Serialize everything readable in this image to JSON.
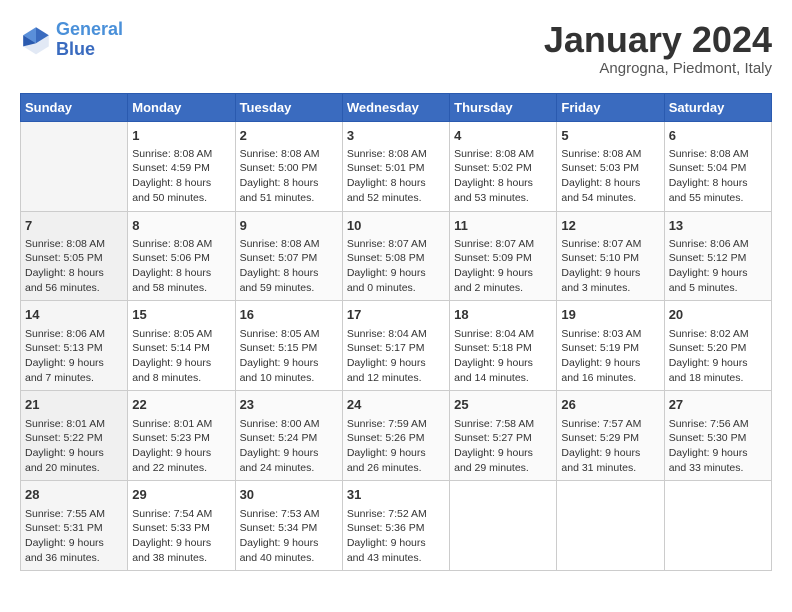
{
  "header": {
    "logo_line1": "General",
    "logo_line2": "Blue",
    "month_title": "January 2024",
    "subtitle": "Angrogna, Piedmont, Italy"
  },
  "weekdays": [
    "Sunday",
    "Monday",
    "Tuesday",
    "Wednesday",
    "Thursday",
    "Friday",
    "Saturday"
  ],
  "weeks": [
    [
      {
        "day": "",
        "info": ""
      },
      {
        "day": "1",
        "info": "Sunrise: 8:08 AM\nSunset: 4:59 PM\nDaylight: 8 hours\nand 50 minutes."
      },
      {
        "day": "2",
        "info": "Sunrise: 8:08 AM\nSunset: 5:00 PM\nDaylight: 8 hours\nand 51 minutes."
      },
      {
        "day": "3",
        "info": "Sunrise: 8:08 AM\nSunset: 5:01 PM\nDaylight: 8 hours\nand 52 minutes."
      },
      {
        "day": "4",
        "info": "Sunrise: 8:08 AM\nSunset: 5:02 PM\nDaylight: 8 hours\nand 53 minutes."
      },
      {
        "day": "5",
        "info": "Sunrise: 8:08 AM\nSunset: 5:03 PM\nDaylight: 8 hours\nand 54 minutes."
      },
      {
        "day": "6",
        "info": "Sunrise: 8:08 AM\nSunset: 5:04 PM\nDaylight: 8 hours\nand 55 minutes."
      }
    ],
    [
      {
        "day": "7",
        "info": "Sunrise: 8:08 AM\nSunset: 5:05 PM\nDaylight: 8 hours\nand 56 minutes."
      },
      {
        "day": "8",
        "info": "Sunrise: 8:08 AM\nSunset: 5:06 PM\nDaylight: 8 hours\nand 58 minutes."
      },
      {
        "day": "9",
        "info": "Sunrise: 8:08 AM\nSunset: 5:07 PM\nDaylight: 8 hours\nand 59 minutes."
      },
      {
        "day": "10",
        "info": "Sunrise: 8:07 AM\nSunset: 5:08 PM\nDaylight: 9 hours\nand 0 minutes."
      },
      {
        "day": "11",
        "info": "Sunrise: 8:07 AM\nSunset: 5:09 PM\nDaylight: 9 hours\nand 2 minutes."
      },
      {
        "day": "12",
        "info": "Sunrise: 8:07 AM\nSunset: 5:10 PM\nDaylight: 9 hours\nand 3 minutes."
      },
      {
        "day": "13",
        "info": "Sunrise: 8:06 AM\nSunset: 5:12 PM\nDaylight: 9 hours\nand 5 minutes."
      }
    ],
    [
      {
        "day": "14",
        "info": "Sunrise: 8:06 AM\nSunset: 5:13 PM\nDaylight: 9 hours\nand 7 minutes."
      },
      {
        "day": "15",
        "info": "Sunrise: 8:05 AM\nSunset: 5:14 PM\nDaylight: 9 hours\nand 8 minutes."
      },
      {
        "day": "16",
        "info": "Sunrise: 8:05 AM\nSunset: 5:15 PM\nDaylight: 9 hours\nand 10 minutes."
      },
      {
        "day": "17",
        "info": "Sunrise: 8:04 AM\nSunset: 5:17 PM\nDaylight: 9 hours\nand 12 minutes."
      },
      {
        "day": "18",
        "info": "Sunrise: 8:04 AM\nSunset: 5:18 PM\nDaylight: 9 hours\nand 14 minutes."
      },
      {
        "day": "19",
        "info": "Sunrise: 8:03 AM\nSunset: 5:19 PM\nDaylight: 9 hours\nand 16 minutes."
      },
      {
        "day": "20",
        "info": "Sunrise: 8:02 AM\nSunset: 5:20 PM\nDaylight: 9 hours\nand 18 minutes."
      }
    ],
    [
      {
        "day": "21",
        "info": "Sunrise: 8:01 AM\nSunset: 5:22 PM\nDaylight: 9 hours\nand 20 minutes."
      },
      {
        "day": "22",
        "info": "Sunrise: 8:01 AM\nSunset: 5:23 PM\nDaylight: 9 hours\nand 22 minutes."
      },
      {
        "day": "23",
        "info": "Sunrise: 8:00 AM\nSunset: 5:24 PM\nDaylight: 9 hours\nand 24 minutes."
      },
      {
        "day": "24",
        "info": "Sunrise: 7:59 AM\nSunset: 5:26 PM\nDaylight: 9 hours\nand 26 minutes."
      },
      {
        "day": "25",
        "info": "Sunrise: 7:58 AM\nSunset: 5:27 PM\nDaylight: 9 hours\nand 29 minutes."
      },
      {
        "day": "26",
        "info": "Sunrise: 7:57 AM\nSunset: 5:29 PM\nDaylight: 9 hours\nand 31 minutes."
      },
      {
        "day": "27",
        "info": "Sunrise: 7:56 AM\nSunset: 5:30 PM\nDaylight: 9 hours\nand 33 minutes."
      }
    ],
    [
      {
        "day": "28",
        "info": "Sunrise: 7:55 AM\nSunset: 5:31 PM\nDaylight: 9 hours\nand 36 minutes."
      },
      {
        "day": "29",
        "info": "Sunrise: 7:54 AM\nSunset: 5:33 PM\nDaylight: 9 hours\nand 38 minutes."
      },
      {
        "day": "30",
        "info": "Sunrise: 7:53 AM\nSunset: 5:34 PM\nDaylight: 9 hours\nand 40 minutes."
      },
      {
        "day": "31",
        "info": "Sunrise: 7:52 AM\nSunset: 5:36 PM\nDaylight: 9 hours\nand 43 minutes."
      },
      {
        "day": "",
        "info": ""
      },
      {
        "day": "",
        "info": ""
      },
      {
        "day": "",
        "info": ""
      }
    ]
  ]
}
